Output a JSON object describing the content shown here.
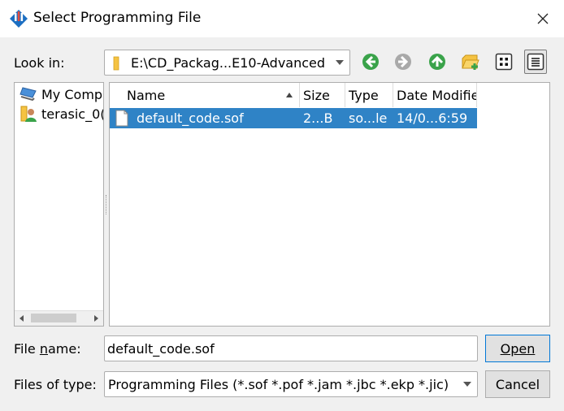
{
  "window": {
    "title": "Select Programming File",
    "close_icon": "close-icon"
  },
  "lookin": {
    "label": "Look in:",
    "path": "E:\\CD_Packag...E10-Advanced",
    "toolbar_icons": [
      "back-icon",
      "forward-icon",
      "up-icon",
      "new-folder-icon",
      "icon-view-icon",
      "detail-view-icon"
    ]
  },
  "sidebar": {
    "items": [
      {
        "label": "My Comp",
        "icon": "computer-icon"
      },
      {
        "label": "terasic_0(",
        "icon": "user-folder-icon"
      }
    ]
  },
  "filelist": {
    "columns": [
      "Name",
      "Size",
      "Type",
      "Date Modifie"
    ],
    "files": [
      {
        "name": "default_code.sof",
        "size": "2...B",
        "type": "so...le",
        "date": "14/0...6:59",
        "selected": true
      }
    ]
  },
  "filename": {
    "label_pre": "File ",
    "label_u": "n",
    "label_post": "ame:",
    "value": "default_code.sof"
  },
  "filetype": {
    "label": "Files of type:",
    "value": "Programming Files (*.sof *.pof *.jam *.jbc *.ekp *.jic)"
  },
  "buttons": {
    "open": "Open",
    "cancel": "Cancel"
  },
  "colors": {
    "selection": "#2f83c6",
    "green_nav": "#3aa34a",
    "grey_nav": "#a9a9a9",
    "folder": "#f5c342"
  }
}
